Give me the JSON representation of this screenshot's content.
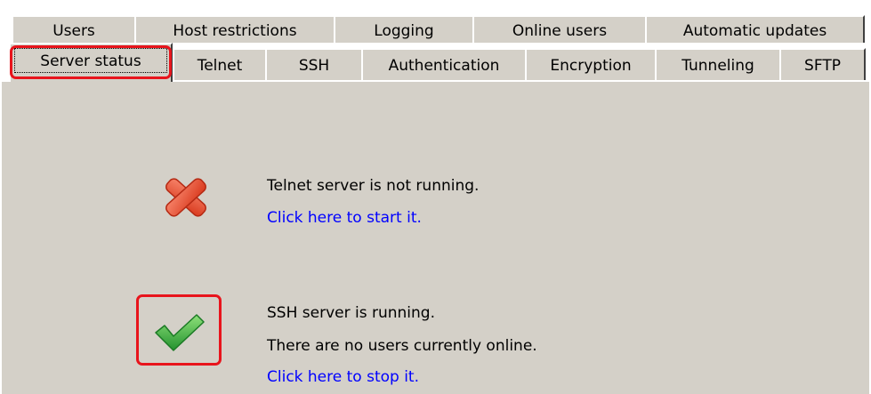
{
  "tabs": {
    "row1": [
      "Users",
      "Host restrictions",
      "Logging",
      "Online users",
      "Automatic updates"
    ],
    "row2": [
      "Server status",
      "Telnet",
      "SSH",
      "Authentication",
      "Encryption",
      "Tunneling",
      "SFTP"
    ],
    "active": "Server status"
  },
  "telnet": {
    "status_text": "Telnet server is not running.",
    "action_link": "Click here to start it.",
    "icon": "red-x-icon"
  },
  "ssh": {
    "status_text": "SSH server is running.",
    "users_text": "There are no users currently online.",
    "action_link": "Click here to stop it.",
    "icon": "green-check-icon"
  },
  "colors": {
    "panel_bg": "#d4d0c8",
    "link": "#0000ff",
    "highlight": "#e8141c",
    "error": "#e8502a",
    "ok": "#3aa53a"
  }
}
